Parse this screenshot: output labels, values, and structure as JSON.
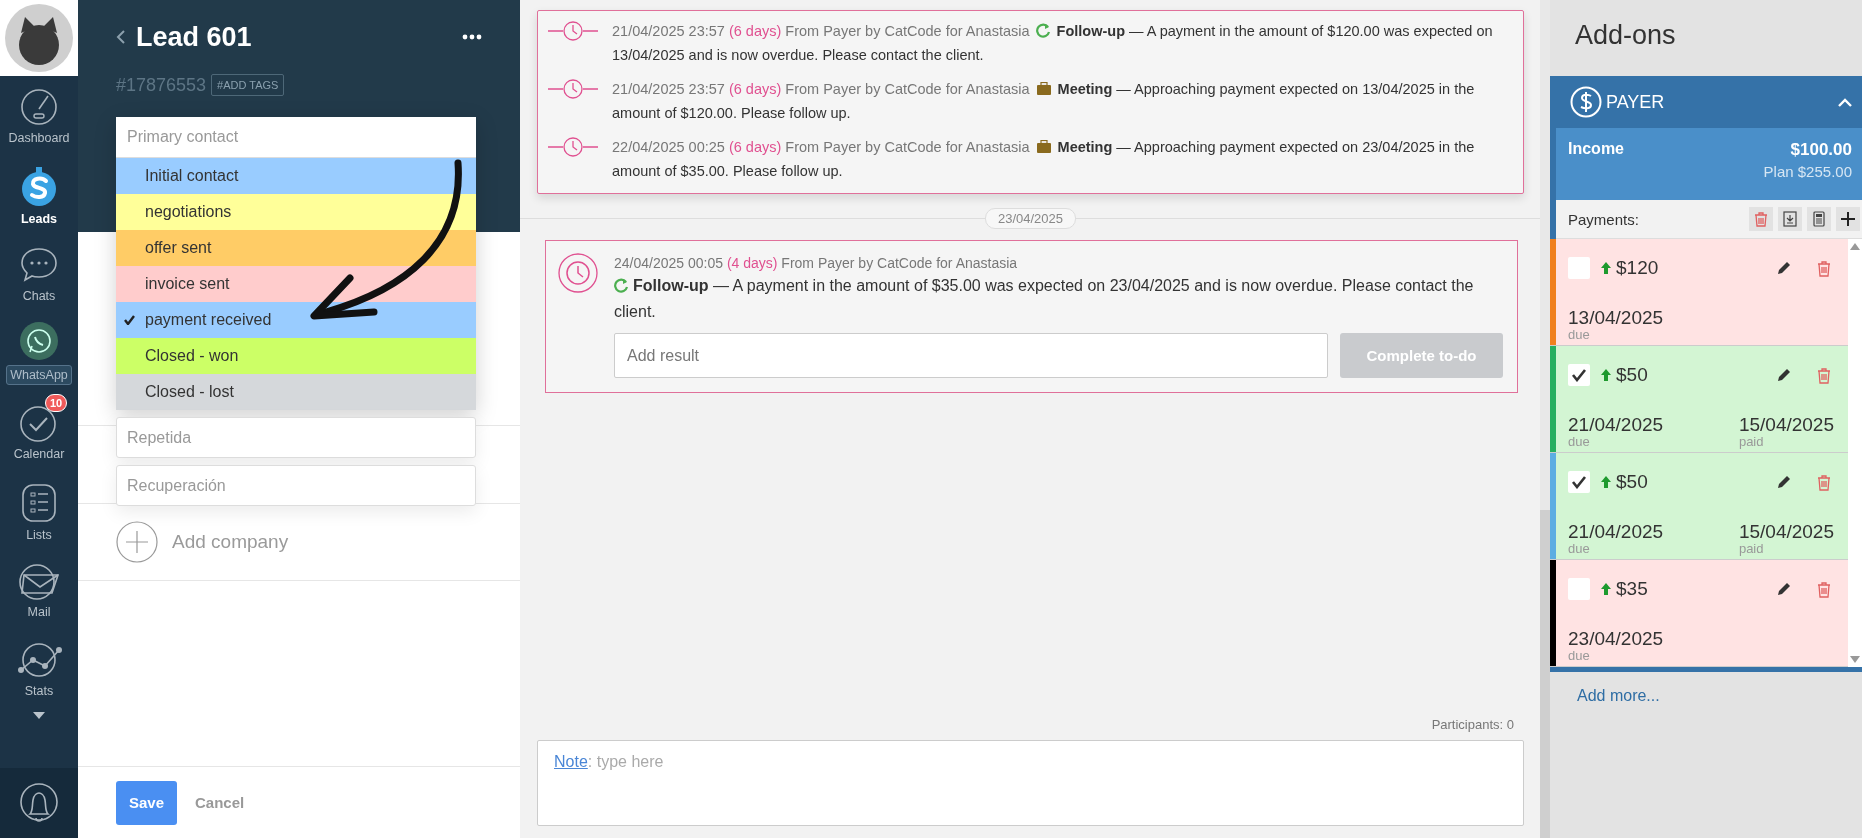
{
  "nav": {
    "items": [
      {
        "kind": "dashboard",
        "label": "Dashboard",
        "selected": false
      },
      {
        "kind": "leads",
        "label": "Leads",
        "selected": true
      },
      {
        "kind": "chats",
        "label": "Chats",
        "selected": false
      },
      {
        "kind": "whatsapp",
        "label": "WhatsApp",
        "selected": false
      },
      {
        "kind": "calendar",
        "label": "Calendar",
        "selected": false,
        "badge": "10"
      },
      {
        "kind": "lists",
        "label": "Lists",
        "selected": false
      },
      {
        "kind": "mail",
        "label": "Mail",
        "selected": false
      },
      {
        "kind": "stats",
        "label": "Stats",
        "selected": false
      }
    ]
  },
  "lead": {
    "title": "Lead 601",
    "number": "#17876553",
    "tags_button": "#ADD TAGS",
    "contact": {
      "placeholder": "Primary contact"
    },
    "stages": [
      {
        "label": "Initial contact",
        "color": "#99ccff",
        "selected": false
      },
      {
        "label": "negotiations",
        "color": "#ffff99",
        "selected": false
      },
      {
        "label": "offer sent",
        "color": "#ffcc66",
        "selected": false
      },
      {
        "label": "invoice sent",
        "color": "#ffcccc",
        "selected": false
      },
      {
        "label": "payment received",
        "color": "#99ccff",
        "selected": true
      },
      {
        "label": "Closed - won",
        "color": "#ccff66",
        "selected": false
      },
      {
        "label": "Closed - lost",
        "color": "#d5d8db",
        "selected": false
      }
    ],
    "extra_fields": [
      {
        "placeholder": "Repetida"
      },
      {
        "placeholder": "Recuperación"
      }
    ],
    "add_company": "Add company",
    "save": "Save",
    "cancel": "Cancel"
  },
  "feed": {
    "notes": [
      {
        "date": "21/04/2025 23:57",
        "ago": "(6 days)",
        "source": "From Payer by CatCode for Anastasia",
        "kind": "followup",
        "type": "Follow-up",
        "text": "— A payment in the amount of $120.00 was expected on 13/04/2025 and is now overdue. Please contact the client."
      },
      {
        "date": "21/04/2025 23:57",
        "ago": "(6 days)",
        "source": "From Payer by CatCode for Anastasia",
        "kind": "meeting",
        "type": "Meeting",
        "text": "— Approaching payment expected on 13/04/2025 in the amount of $120.00. Please follow up."
      },
      {
        "date": "22/04/2025 00:25",
        "ago": "(6 days)",
        "source": "From Payer by CatCode for Anastasia",
        "kind": "meeting",
        "type": "Meeting",
        "text": "— Approaching payment expected on 23/04/2025 in the amount of $35.00. Please follow up."
      }
    ],
    "date_separator": "23/04/2025",
    "task": {
      "date": "24/04/2025 00:05",
      "ago": "(4 days)",
      "source": "From Payer by CatCode for Anastasia",
      "kind": "followup",
      "type": "Follow-up",
      "text": "— A payment in the amount of $35.00 was expected on 23/04/2025 and is now overdue. Please contact the client.",
      "result": {
        "placeholder": "Add result"
      },
      "complete_button": "Complete to-do"
    },
    "participants": "Participants: 0",
    "note": {
      "link": "Note",
      "placeholder": ": type here"
    }
  },
  "addons": {
    "title": "Add-ons",
    "payer": {
      "name": "PAYER",
      "income_label": "Income",
      "income": "$100.00",
      "plan": "Plan $255.00",
      "payments_label": "Payments:",
      "payments": [
        {
          "color": "#f0801e",
          "checked": false,
          "amount": "$120",
          "due": "13/04/2025",
          "due_label": "due"
        },
        {
          "color": "#27ae60",
          "checked": true,
          "amount": "$50",
          "due": "21/04/2025",
          "due_label": "due",
          "paid": "15/04/2025",
          "paid_label": "paid"
        },
        {
          "color": "#5dade2",
          "checked": true,
          "amount": "$50",
          "due": "21/04/2025",
          "due_label": "due",
          "paid": "15/04/2025",
          "paid_label": "paid"
        },
        {
          "color": "#000000",
          "checked": false,
          "amount": "$35",
          "due": "23/04/2025",
          "due_label": "due"
        }
      ],
      "add_more": "Add more..."
    }
  }
}
